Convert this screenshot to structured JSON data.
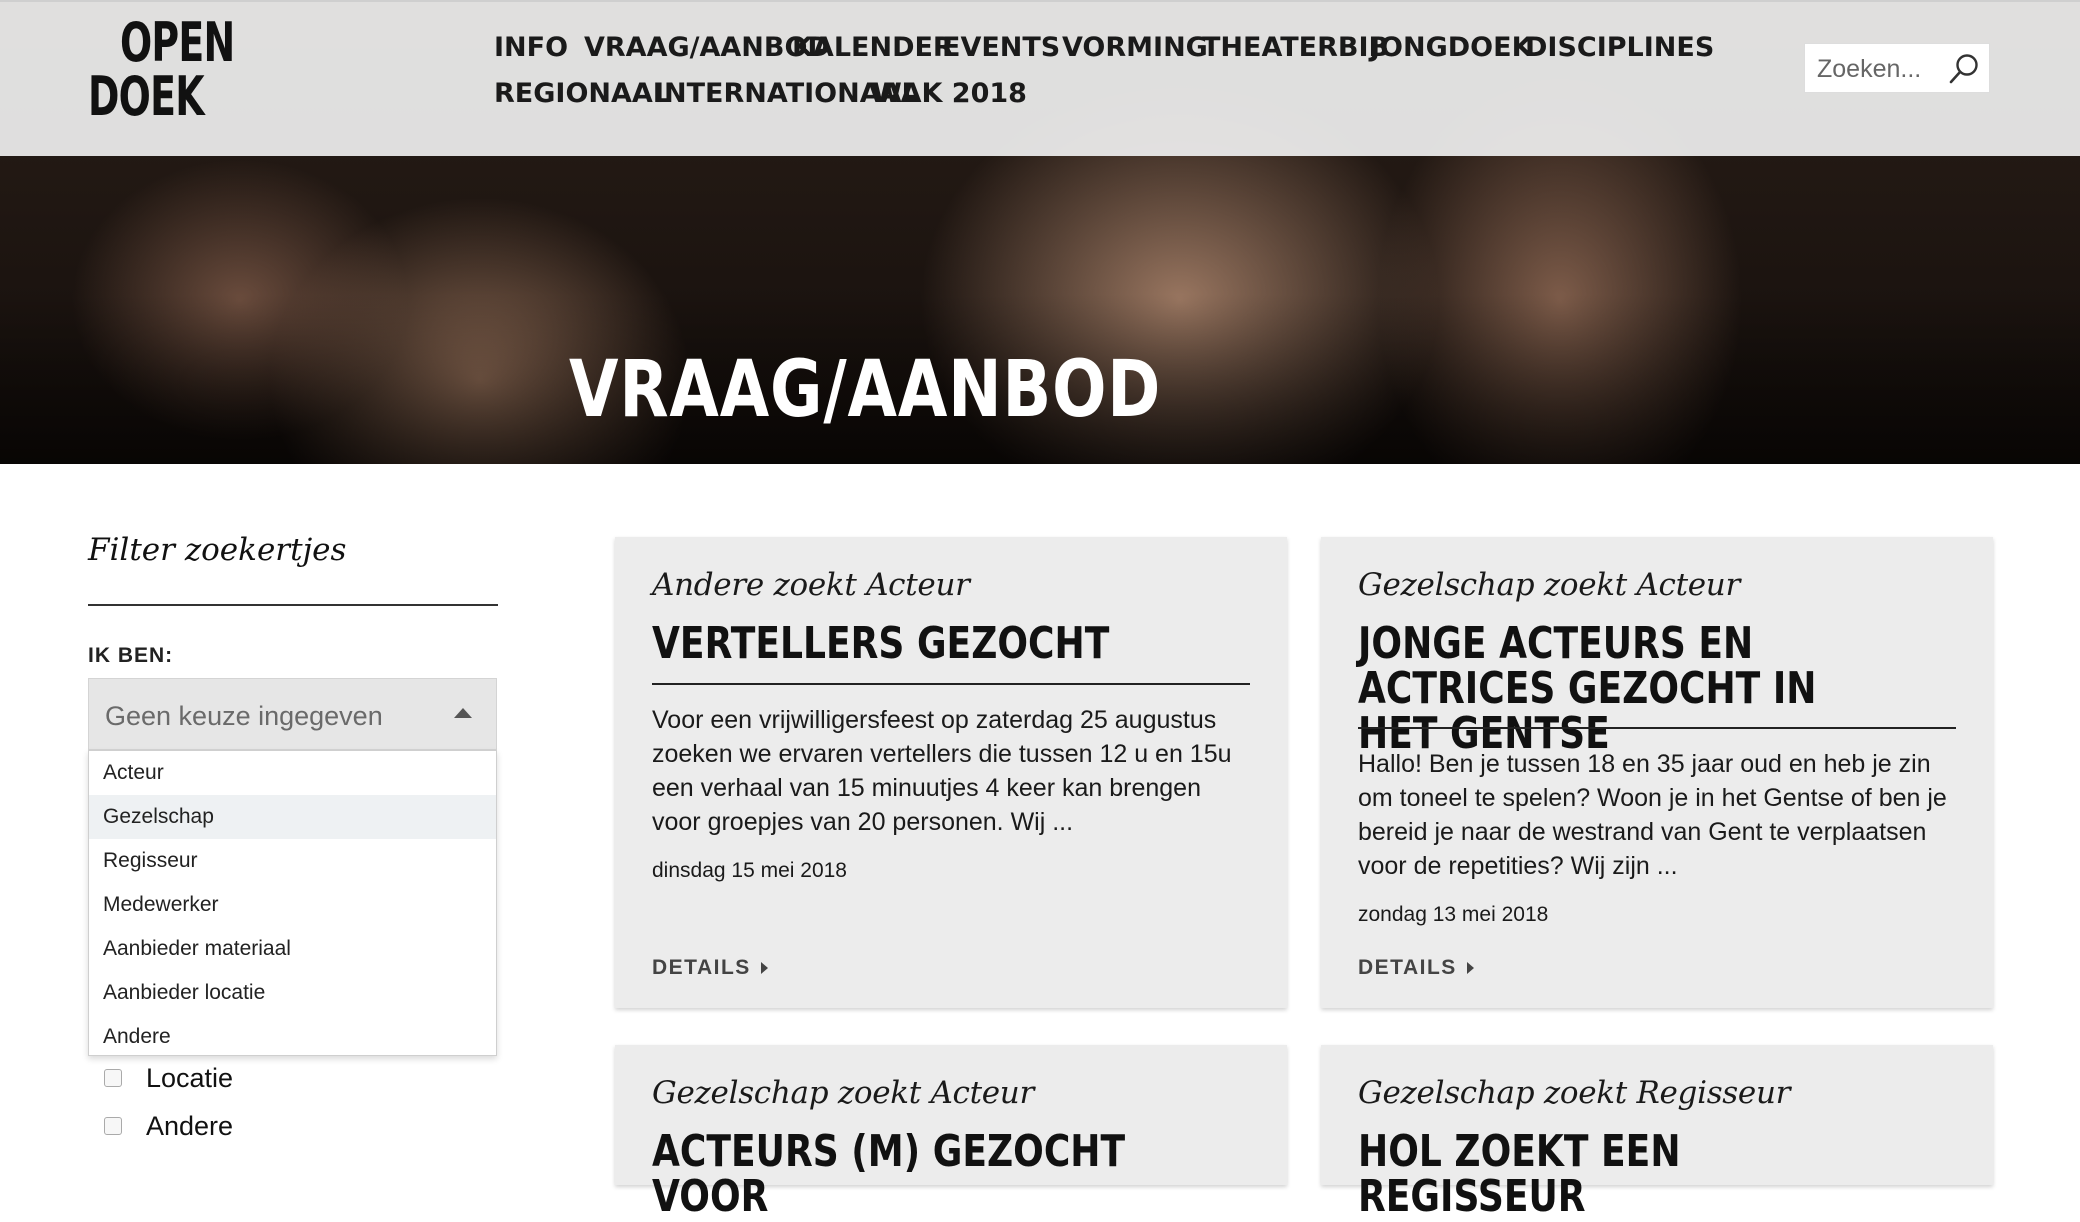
{
  "header": {
    "logo": {
      "line1": "OPEN",
      "line2": "DOEK"
    },
    "nav_row1": [
      "INFO",
      "VRAAG/AANBOD",
      "KALENDER",
      "EVENTS",
      "VORMING",
      "THEATERBIB",
      "JONGDOEK",
      "DISCIPLINES"
    ],
    "nav_row2": [
      "REGIONAAL",
      "INTERNATIONAAL",
      "WAK 2018"
    ],
    "search": {
      "placeholder": "Zoeken..."
    }
  },
  "hero": {
    "title": "VRAAG/AANBOD"
  },
  "sidebar": {
    "title": "Filter zoekertjes",
    "ik_ben_label": "IK BEN:",
    "select": {
      "value": "Geen keuze ingegeven"
    },
    "dropdown_options": [
      "Acteur",
      "Gezelschap",
      "Regisseur",
      "Medewerker",
      "Aanbieder materiaal",
      "Aanbieder locatie",
      "Andere"
    ],
    "highlighted_option": "Gezelschap",
    "checkboxes": [
      {
        "label": "Locatie",
        "checked": false
      },
      {
        "label": "Andere",
        "checked": false
      }
    ]
  },
  "cards": [
    {
      "subtitle": "Andere zoekt Acteur",
      "title": "VERTELLERS GEZOCHT",
      "body": "Voor een vrijwilligersfeest op zaterdag 25 augustus zoeken we ervaren vertellers die tussen 12 u en 15u een verhaal van 15 minuutjes 4 keer kan brengen voor groepjes van 20 personen. Wij ...",
      "date": "dinsdag 15 mei 2018",
      "details": "DETAILS"
    },
    {
      "subtitle": "Gezelschap zoekt Acteur",
      "title": "JONGE ACTEURS EN ACTRICES GEZOCHT IN HET GENTSE",
      "body": "Hallo! Ben je tussen 18 en 35 jaar oud en heb je zin om toneel te spelen? Woon je in het Gentse of ben je bereid je naar de westrand van Gent te verplaatsen voor de repetities? Wij zijn ...",
      "date": "zondag 13 mei 2018",
      "details": "DETAILS"
    },
    {
      "subtitle": "Gezelschap zoekt Acteur",
      "title": "ACTEURS (M) GEZOCHT VOOR"
    },
    {
      "subtitle": "Gezelschap zoekt Regisseur",
      "title": "HOL ZOEKT EEN REGISSEUR"
    }
  ]
}
